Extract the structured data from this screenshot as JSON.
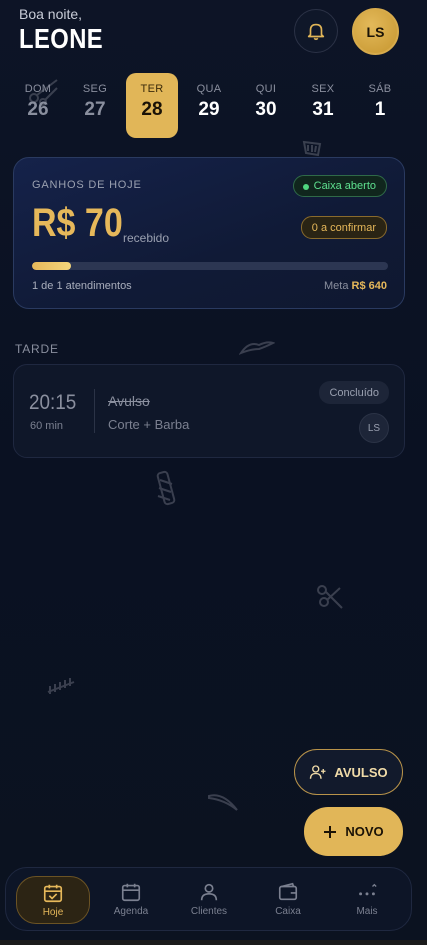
{
  "header": {
    "greeting": "Boa noite,",
    "name": "LEONE",
    "avatar_initials": "LS",
    "bell_icon": "bell-icon"
  },
  "week": [
    {
      "day": "DOM",
      "date": "26",
      "state": "past"
    },
    {
      "day": "SEG",
      "date": "27",
      "state": "past"
    },
    {
      "day": "TER",
      "date": "28",
      "state": "active"
    },
    {
      "day": "QUA",
      "date": "29",
      "state": "future"
    },
    {
      "day": "QUI",
      "date": "30",
      "state": "future"
    },
    {
      "day": "SEX",
      "date": "31",
      "state": "future"
    },
    {
      "day": "SÁB",
      "date": "1",
      "state": "future"
    }
  ],
  "earnings": {
    "title": "GANHOS DE HOJE",
    "cash_status": "Caixa aberto",
    "amount": "R$ 70",
    "received_label": "recebido",
    "to_confirm": "0 a confirmar",
    "progress": 0.11,
    "appointments_text": "1 de 1 atendimentos",
    "goal_label": "Meta",
    "goal_value": "R$ 640"
  },
  "section_label": "TARDE",
  "appointment": {
    "time": "20:15",
    "duration": "60 min",
    "client": "Avulso",
    "service": "Corte + Barba",
    "status": "Concluído",
    "avatar_initials": "LS"
  },
  "actions": {
    "avulso": "AVULSO",
    "novo": "NOVO"
  },
  "tabs": [
    {
      "label": "Hoje",
      "icon": "calendar-check-icon",
      "active": true
    },
    {
      "label": "Agenda",
      "icon": "calendar-icon",
      "active": false
    },
    {
      "label": "Clientes",
      "icon": "user-icon",
      "active": false
    },
    {
      "label": "Caixa",
      "icon": "wallet-icon",
      "active": false
    },
    {
      "label": "Mais",
      "icon": "more-icon",
      "active": false
    }
  ],
  "colors": {
    "accent": "#e1b658",
    "background": "#0b1220",
    "success": "#4fd67f"
  }
}
